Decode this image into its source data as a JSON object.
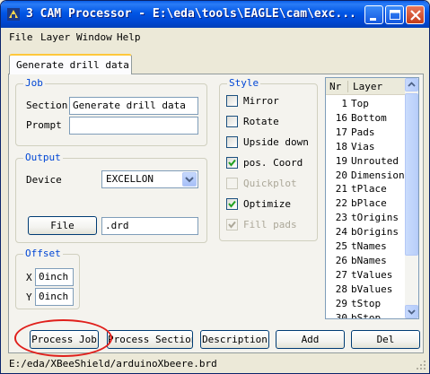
{
  "window": {
    "title": "3 CAM Processor - E:\\eda\\tools\\EAGLE\\cam\\exc..."
  },
  "menu": [
    "File",
    "Layer",
    "Window",
    "Help"
  ],
  "tab": {
    "label": "Generate drill data"
  },
  "job": {
    "group_title": "Job",
    "section_label": "Section",
    "section_value": "Generate drill data",
    "prompt_label": "Prompt",
    "prompt_value": ""
  },
  "output": {
    "group_title": "Output",
    "device_label": "Device",
    "device_value": "EXCELLON",
    "file_button": "File",
    "file_value": ".drd"
  },
  "offset": {
    "group_title": "Offset",
    "x_label": "X",
    "x_value": "0inch",
    "y_label": "Y",
    "y_value": "0inch"
  },
  "style": {
    "group_title": "Style",
    "options": [
      {
        "label": "Mirror",
        "checked": false,
        "enabled": true
      },
      {
        "label": "Rotate",
        "checked": false,
        "enabled": true
      },
      {
        "label": "Upside down",
        "checked": false,
        "enabled": true
      },
      {
        "label": "pos. Coord",
        "checked": true,
        "enabled": true
      },
      {
        "label": "Quickplot",
        "checked": false,
        "enabled": false
      },
      {
        "label": "Optimize",
        "checked": true,
        "enabled": true
      },
      {
        "label": "Fill pads",
        "checked": true,
        "enabled": false
      }
    ]
  },
  "layers": {
    "col_nr": "Nr",
    "col_layer": "Layer",
    "rows": [
      {
        "nr": "1",
        "name": "Top"
      },
      {
        "nr": "16",
        "name": "Bottom"
      },
      {
        "nr": "17",
        "name": "Pads"
      },
      {
        "nr": "18",
        "name": "Vias"
      },
      {
        "nr": "19",
        "name": "Unrouted"
      },
      {
        "nr": "20",
        "name": "Dimension"
      },
      {
        "nr": "21",
        "name": "tPlace"
      },
      {
        "nr": "22",
        "name": "bPlace"
      },
      {
        "nr": "23",
        "name": "tOrigins"
      },
      {
        "nr": "24",
        "name": "bOrigins"
      },
      {
        "nr": "25",
        "name": "tNames"
      },
      {
        "nr": "26",
        "name": "bNames"
      },
      {
        "nr": "27",
        "name": "tValues"
      },
      {
        "nr": "28",
        "name": "bValues"
      },
      {
        "nr": "29",
        "name": "tStop"
      },
      {
        "nr": "30",
        "name": "bStop"
      }
    ]
  },
  "buttons": {
    "process_job": "Process Job",
    "process_section": "Process Section",
    "description": "Description",
    "add": "Add",
    "del": "Del"
  },
  "status": {
    "path": "E:/eda/XBeeShield/arduinoXbeere.brd"
  },
  "colors": {
    "group_title": "#0046d5",
    "highlight": "#e0201c",
    "titlebar": "#0055e5"
  }
}
